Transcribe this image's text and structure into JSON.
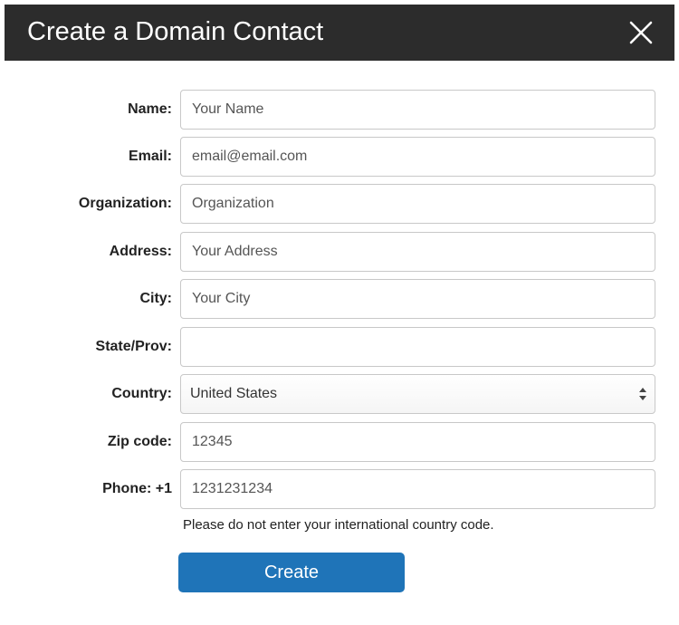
{
  "header": {
    "title": "Create a Domain Contact",
    "close_icon": "close-icon"
  },
  "form": {
    "name": {
      "label": "Name:",
      "placeholder": "Your Name",
      "value": ""
    },
    "email": {
      "label": "Email:",
      "placeholder": "email@email.com",
      "value": ""
    },
    "organization": {
      "label": "Organization:",
      "placeholder": "Organization",
      "value": ""
    },
    "address": {
      "label": "Address:",
      "placeholder": "Your Address",
      "value": ""
    },
    "city": {
      "label": "City:",
      "placeholder": "Your City",
      "value": ""
    },
    "state": {
      "label": "State/Prov:",
      "placeholder": "",
      "value": ""
    },
    "country": {
      "label": "Country:",
      "selected": "United States"
    },
    "zip": {
      "label": "Zip code:",
      "placeholder": "12345",
      "value": ""
    },
    "phone": {
      "label": "Phone: +1",
      "placeholder": "1231231234",
      "value": ""
    },
    "hint": "Please do not enter your international country code."
  },
  "actions": {
    "create_label": "Create"
  },
  "colors": {
    "header_bg": "#2c2c2c",
    "primary_button": "#1f74b8",
    "field_border": "#c8c8c8"
  }
}
